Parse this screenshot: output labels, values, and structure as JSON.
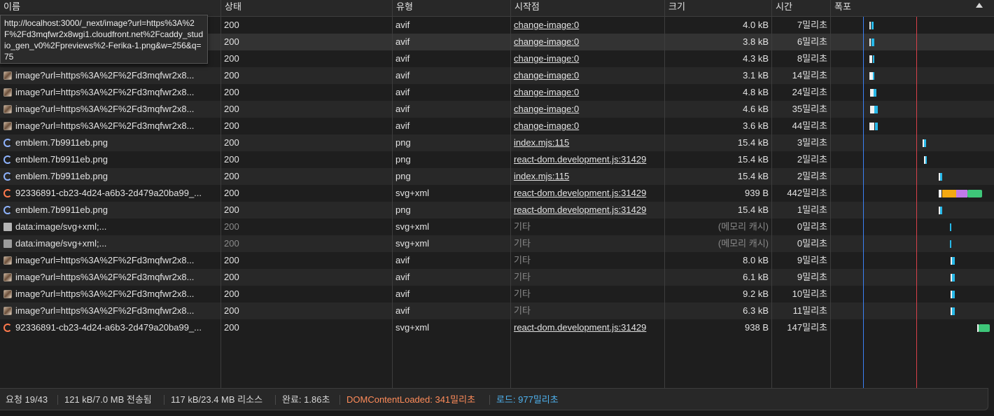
{
  "columns": {
    "name": "이름",
    "status": "상태",
    "type": "유형",
    "initiator": "시작점",
    "size": "크기",
    "time": "시간",
    "waterfall": "폭포"
  },
  "tooltip": "http://localhost:3000/_next/image?url=https%3A%2F%2Fd3mqfwr2x8wgi1.cloudfront.net%2Fcaddy_studio_gen_v0%2Fpreviews%2-Ferika-1.png&w=256&q=75",
  "rows": [
    {
      "name": "image?url=https%3A%2F%2Fd3mqfwr2x8...",
      "icon": "image-thumbnail-icon",
      "status": "200",
      "type": "avif",
      "initiator": "change-image:0",
      "initiator_kind": "link",
      "size": "4.0 kB",
      "time": "7밀리초"
    },
    {
      "name": "image?url=https%3A%2F%2Fd3mqfwr2x8...",
      "icon": "image-thumbnail-icon",
      "status": "200",
      "type": "avif",
      "initiator": "change-image:0",
      "initiator_kind": "link",
      "size": "3.8 kB",
      "time": "6밀리초"
    },
    {
      "name": "image?url=https%3A%2F%2Fd3mqfwr2x8...",
      "icon": "image-thumbnail-icon",
      "status": "200",
      "type": "avif",
      "initiator": "change-image:0",
      "initiator_kind": "link",
      "size": "4.3 kB",
      "time": "8밀리초"
    },
    {
      "name": "image?url=https%3A%2F%2Fd3mqfwr2x8...",
      "icon": "image-thumbnail-icon",
      "status": "200",
      "type": "avif",
      "initiator": "change-image:0",
      "initiator_kind": "link",
      "size": "3.1 kB",
      "time": "14밀리초"
    },
    {
      "name": "image?url=https%3A%2F%2Fd3mqfwr2x8...",
      "icon": "image-thumbnail-icon",
      "status": "200",
      "type": "avif",
      "initiator": "change-image:0",
      "initiator_kind": "link",
      "size": "4.8 kB",
      "time": "24밀리초"
    },
    {
      "name": "image?url=https%3A%2F%2Fd3mqfwr2x8...",
      "icon": "image-thumbnail-icon",
      "status": "200",
      "type": "avif",
      "initiator": "change-image:0",
      "initiator_kind": "link",
      "size": "4.6 kB",
      "time": "35밀리초"
    },
    {
      "name": "image?url=https%3A%2F%2Fd3mqfwr2x8...",
      "icon": "image-thumbnail-icon",
      "status": "200",
      "type": "avif",
      "initiator": "change-image:0",
      "initiator_kind": "link",
      "size": "3.6 kB",
      "time": "44밀리초"
    },
    {
      "name": "emblem.7b9911eb.png",
      "icon": "emblem-icon",
      "status": "200",
      "type": "png",
      "initiator": "index.mjs:115",
      "initiator_kind": "link",
      "size": "15.4 kB",
      "time": "3밀리초"
    },
    {
      "name": "emblem.7b9911eb.png",
      "icon": "emblem-icon",
      "status": "200",
      "type": "png",
      "initiator": "react-dom.development.js:31429",
      "initiator_kind": "link",
      "size": "15.4 kB",
      "time": "2밀리초"
    },
    {
      "name": "emblem.7b9911eb.png",
      "icon": "emblem-icon",
      "status": "200",
      "type": "png",
      "initiator": "index.mjs:115",
      "initiator_kind": "link",
      "size": "15.4 kB",
      "time": "2밀리초"
    },
    {
      "name": "92336891-cb23-4d24-a6b3-2d479a20ba99_...",
      "icon": "svg-file-icon",
      "status": "200",
      "type": "svg+xml",
      "initiator": "react-dom.development.js:31429",
      "initiator_kind": "link",
      "size": "939 B",
      "time": "442밀리초"
    },
    {
      "name": "emblem.7b9911eb.png",
      "icon": "emblem-icon",
      "status": "200",
      "type": "png",
      "initiator": "react-dom.development.js:31429",
      "initiator_kind": "link",
      "size": "15.4 kB",
      "time": "1밀리초"
    },
    {
      "name": "data:image/svg+xml;...",
      "icon": "data-uri-icon",
      "status": "200",
      "status_dim": true,
      "type": "svg+xml",
      "initiator": "기타",
      "initiator_kind": "other",
      "size": "(메모리 캐시)",
      "size_dim": true,
      "time": "0밀리초"
    },
    {
      "name": "data:image/svg+xml;...",
      "icon": "data-uri-icon",
      "status": "200",
      "status_dim": true,
      "type": "svg+xml",
      "initiator": "기타",
      "initiator_kind": "other",
      "size": "(메모리 캐시)",
      "size_dim": true,
      "time": "0밀리초"
    },
    {
      "name": "image?url=https%3A%2F%2Fd3mqfwr2x8...",
      "icon": "image-thumbnail-icon",
      "status": "200",
      "type": "avif",
      "initiator": "기타",
      "initiator_kind": "other",
      "size": "8.0 kB",
      "time": "9밀리초"
    },
    {
      "name": "image?url=https%3A%2F%2Fd3mqfwr2x8...",
      "icon": "image-thumbnail-icon",
      "status": "200",
      "type": "avif",
      "initiator": "기타",
      "initiator_kind": "other",
      "size": "6.1 kB",
      "time": "9밀리초"
    },
    {
      "name": "image?url=https%3A%2F%2Fd3mqfwr2x8...",
      "icon": "image-thumbnail-icon",
      "status": "200",
      "type": "avif",
      "initiator": "기타",
      "initiator_kind": "other",
      "size": "9.2 kB",
      "time": "10밀리초"
    },
    {
      "name": "image?url=https%3A%2F%2Fd3mqfwr2x8...",
      "icon": "image-thumbnail-icon",
      "status": "200",
      "type": "avif",
      "initiator": "기타",
      "initiator_kind": "other",
      "size": "6.3 kB",
      "time": "11밀리초"
    },
    {
      "name": "92336891-cb23-4d24-a6b3-2d479a20ba99_...",
      "icon": "svg-file-icon",
      "status": "200",
      "type": "svg+xml",
      "initiator": "react-dom.development.js:31429",
      "initiator_kind": "link",
      "size": "938 B",
      "time": "147밀리초"
    }
  ],
  "footer": {
    "requests": "요청 19/43",
    "transferred": "121 kB/7.0 MB 전송됨",
    "resources": "117 kB/23.4 MB 리소스",
    "finish": "완료: 1.86초",
    "dom_content_loaded": "DOMContentLoaded: 341밀리초",
    "load": "로드: 977밀리초"
  },
  "colors": {
    "dom_content_loaded_line": "#3b82f6",
    "load_line": "#d9414a",
    "dom_content_loaded_text": "#ff8c5a",
    "load_text": "#4fb3f0"
  }
}
